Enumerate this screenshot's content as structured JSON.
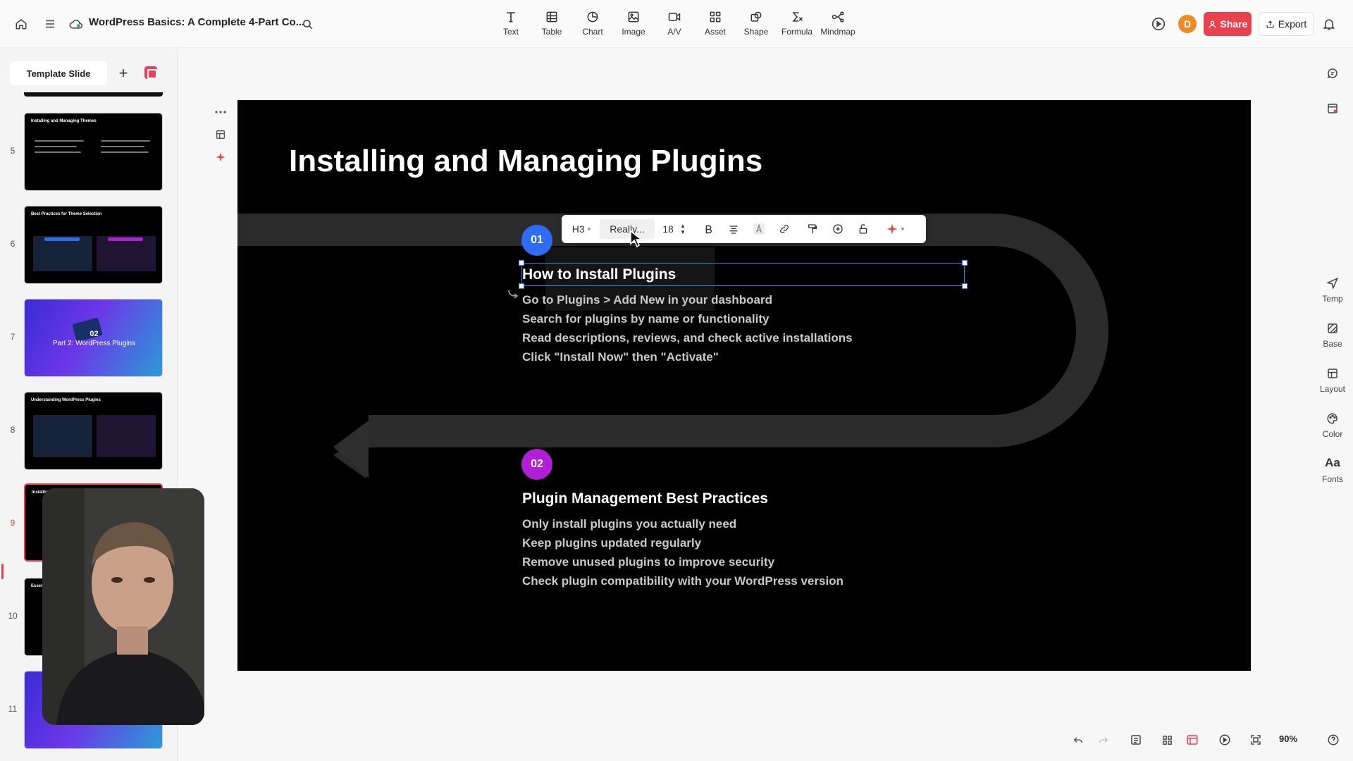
{
  "header": {
    "doc_title": "WordPress Basics: A Complete 4-Part Co...",
    "tools": [
      {
        "label": "Text",
        "icon": "text-icon"
      },
      {
        "label": "Table",
        "icon": "table-icon"
      },
      {
        "label": "Chart",
        "icon": "chart-icon"
      },
      {
        "label": "Image",
        "icon": "image-icon"
      },
      {
        "label": "A/V",
        "icon": "video-icon"
      },
      {
        "label": "Asset",
        "icon": "asset-icon"
      },
      {
        "label": "Shape",
        "icon": "shape-icon"
      },
      {
        "label": "Formula",
        "icon": "formula-icon"
      },
      {
        "label": "Mindmap",
        "icon": "mindmap-icon"
      }
    ],
    "avatar_letter": "D",
    "share_label": "Share",
    "export_label": "Export"
  },
  "sidebar": {
    "template_label": "Template Slide",
    "add_label": "+",
    "slides": [
      {
        "num": "5",
        "title": "Installing and Managing Themes"
      },
      {
        "num": "6",
        "title": "Best Practices for Theme Selection"
      },
      {
        "num": "7",
        "title": "02",
        "subtitle": "Part 2: WordPress Plugins"
      },
      {
        "num": "8",
        "title": "Understanding WordPress Plugins"
      },
      {
        "num": "9",
        "title": "Installin"
      },
      {
        "num": "10",
        "title": "Essent"
      },
      {
        "num": "11",
        "title": ""
      }
    ]
  },
  "slide": {
    "title": "Installing and Managing Plugins",
    "sections": [
      {
        "badge": "01",
        "heading": "How to Install Plugins",
        "bullets": [
          "Go to Plugins > Add New in your dashboard",
          "Search for plugins by name or functionality",
          "Read descriptions, reviews, and check active installations",
          "Click \"Install Now\" then \"Activate\""
        ]
      },
      {
        "badge": "02",
        "heading": "Plugin Management Best Practices",
        "bullets": [
          "Only install plugins you actually need",
          "Keep plugins updated regularly",
          "Remove unused plugins to improve security",
          "Check plugin compatibility with your WordPress version"
        ]
      }
    ]
  },
  "text_toolbar": {
    "heading_level": "H3",
    "font_name": "Really...",
    "font_size": "18"
  },
  "right_panel": [
    {
      "label": "Temp",
      "icon": "template-icon"
    },
    {
      "label": "Base",
      "icon": "base-icon"
    },
    {
      "label": "Layout",
      "icon": "layout-icon"
    },
    {
      "label": "Color",
      "icon": "palette-icon"
    },
    {
      "label": "Fonts",
      "icon": "fonts-icon",
      "glyph": "Aa"
    }
  ],
  "footer": {
    "zoom": "90%"
  },
  "colors": {
    "accent": "#e8424f",
    "badge_blue": "#2f6cf5",
    "badge_purple": "#b01fd6",
    "selection": "#2d7df6"
  }
}
